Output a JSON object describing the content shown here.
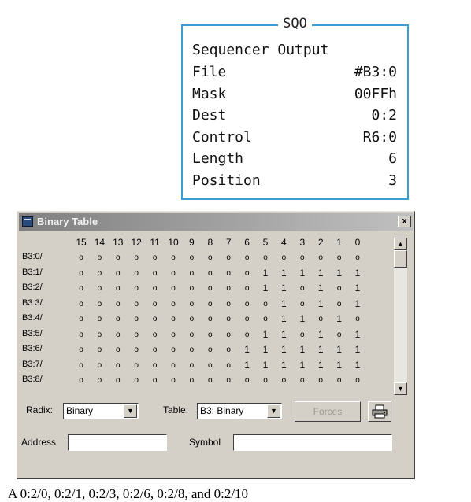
{
  "sqo": {
    "title": "SQO",
    "rows": [
      {
        "label": "Sequencer Output",
        "value": ""
      },
      {
        "label": "File",
        "value": "#B3:0"
      },
      {
        "label": "Mask",
        "value": "00FFh"
      },
      {
        "label": "Dest",
        "value": "0:2"
      },
      {
        "label": "Control",
        "value": "R6:0"
      },
      {
        "label": "Length",
        "value": "6"
      },
      {
        "label": "Position",
        "value": "3"
      }
    ]
  },
  "window": {
    "title": "Binary Table",
    "close_label": "x"
  },
  "table": {
    "columns": [
      "15",
      "14",
      "13",
      "12",
      "11",
      "10",
      "9",
      "8",
      "7",
      "6",
      "5",
      "4",
      "3",
      "2",
      "1",
      "0"
    ],
    "rows": [
      {
        "label": "B3:0/",
        "bits": [
          "o",
          "o",
          "o",
          "o",
          "o",
          "o",
          "o",
          "o",
          "o",
          "o",
          "o",
          "o",
          "o",
          "o",
          "o",
          "o"
        ]
      },
      {
        "label": "B3:1/",
        "bits": [
          "o",
          "o",
          "o",
          "o",
          "o",
          "o",
          "o",
          "o",
          "o",
          "o",
          "1",
          "1",
          "1",
          "1",
          "1",
          "1"
        ]
      },
      {
        "label": "B3:2/",
        "bits": [
          "o",
          "o",
          "o",
          "o",
          "o",
          "o",
          "o",
          "o",
          "o",
          "o",
          "1",
          "1",
          "o",
          "1",
          "o",
          "1"
        ]
      },
      {
        "label": "B3:3/",
        "bits": [
          "o",
          "o",
          "o",
          "o",
          "o",
          "o",
          "o",
          "o",
          "o",
          "o",
          "o",
          "1",
          "o",
          "1",
          "o",
          "1"
        ]
      },
      {
        "label": "B3:4/",
        "bits": [
          "o",
          "o",
          "o",
          "o",
          "o",
          "o",
          "o",
          "o",
          "o",
          "o",
          "o",
          "1",
          "1",
          "o",
          "1",
          "o"
        ]
      },
      {
        "label": "B3:5/",
        "bits": [
          "o",
          "o",
          "o",
          "o",
          "o",
          "o",
          "o",
          "o",
          "o",
          "o",
          "1",
          "1",
          "o",
          "1",
          "o",
          "1"
        ]
      },
      {
        "label": "B3:6/",
        "bits": [
          "o",
          "o",
          "o",
          "o",
          "o",
          "o",
          "o",
          "o",
          "o",
          "1",
          "1",
          "1",
          "1",
          "1",
          "1",
          "1"
        ]
      },
      {
        "label": "B3:7/",
        "bits": [
          "o",
          "o",
          "o",
          "o",
          "o",
          "o",
          "o",
          "o",
          "o",
          "1",
          "1",
          "1",
          "1",
          "1",
          "1",
          "1"
        ]
      },
      {
        "label": "B3:8/",
        "bits": [
          "o",
          "o",
          "o",
          "o",
          "o",
          "o",
          "o",
          "o",
          "o",
          "o",
          "o",
          "o",
          "o",
          "o",
          "o",
          "o"
        ]
      }
    ]
  },
  "controls": {
    "radix_label": "Radix:",
    "radix_value": "Binary",
    "table_label": "Table:",
    "table_value": "B3: Binary",
    "forces_label": "Forces",
    "print_icon": "printer-icon",
    "address_label": "Address",
    "address_value": "",
    "symbol_label": "Symbol",
    "symbol_value": ""
  },
  "caption": "A  0:2/0, 0:2/1, 0:2/3, 0:2/6, 0:2/8, and 0:2/10"
}
